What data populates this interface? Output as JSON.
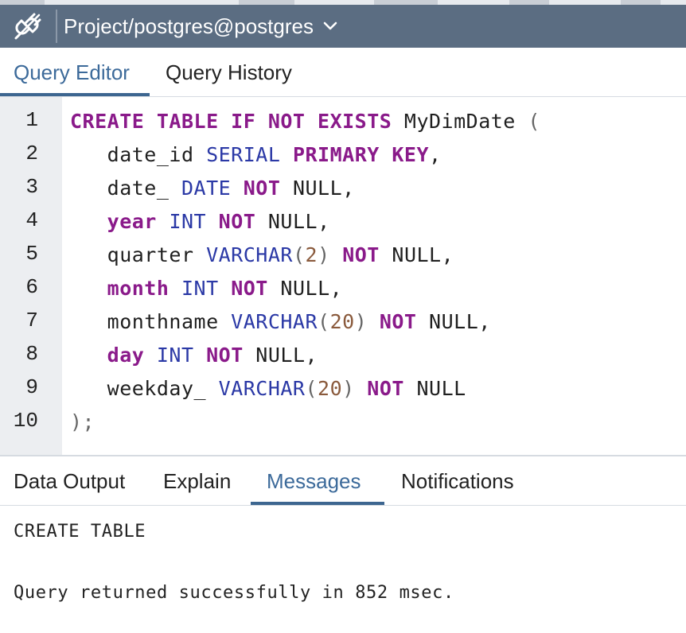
{
  "connection": {
    "label": "Project/postgres@postgres",
    "icon": "connection-plug-icon",
    "dropdown_icon": "chevron-down-icon"
  },
  "editor_tabs": [
    {
      "label": "Query Editor",
      "active": true
    },
    {
      "label": "Query History",
      "active": false
    }
  ],
  "editor": {
    "line_numbers": [
      "1",
      "2",
      "3",
      "4",
      "5",
      "6",
      "7",
      "8",
      "9",
      "10"
    ],
    "lines": [
      [
        {
          "t": "kw",
          "v": "CREATE TABLE IF NOT EXISTS"
        },
        {
          "t": "id",
          "v": " MyDimDate "
        },
        {
          "t": "pun",
          "v": "("
        }
      ],
      [
        {
          "t": "id",
          "v": "   date_id "
        },
        {
          "t": "ty",
          "v": "SERIAL"
        },
        {
          "t": "id",
          "v": " "
        },
        {
          "t": "kw",
          "v": "PRIMARY KEY"
        },
        {
          "t": "id",
          "v": ","
        }
      ],
      [
        {
          "t": "id",
          "v": "   date_ "
        },
        {
          "t": "ty",
          "v": "DATE"
        },
        {
          "t": "id",
          "v": " "
        },
        {
          "t": "kw",
          "v": "NOT"
        },
        {
          "t": "id",
          "v": " NULL,"
        }
      ],
      [
        {
          "t": "id",
          "v": "   "
        },
        {
          "t": "kw",
          "v": "year"
        },
        {
          "t": "id",
          "v": " "
        },
        {
          "t": "ty",
          "v": "INT"
        },
        {
          "t": "id",
          "v": " "
        },
        {
          "t": "kw",
          "v": "NOT"
        },
        {
          "t": "id",
          "v": " NULL,"
        }
      ],
      [
        {
          "t": "id",
          "v": "   quarter "
        },
        {
          "t": "ty",
          "v": "VARCHAR"
        },
        {
          "t": "pun",
          "v": "("
        },
        {
          "t": "num",
          "v": "2"
        },
        {
          "t": "pun",
          "v": ")"
        },
        {
          "t": "id",
          "v": " "
        },
        {
          "t": "kw",
          "v": "NOT"
        },
        {
          "t": "id",
          "v": " NULL,"
        }
      ],
      [
        {
          "t": "id",
          "v": "   "
        },
        {
          "t": "kw",
          "v": "month"
        },
        {
          "t": "id",
          "v": " "
        },
        {
          "t": "ty",
          "v": "INT"
        },
        {
          "t": "id",
          "v": " "
        },
        {
          "t": "kw",
          "v": "NOT"
        },
        {
          "t": "id",
          "v": " NULL,"
        }
      ],
      [
        {
          "t": "id",
          "v": "   monthname "
        },
        {
          "t": "ty",
          "v": "VARCHAR"
        },
        {
          "t": "pun",
          "v": "("
        },
        {
          "t": "num",
          "v": "20"
        },
        {
          "t": "pun",
          "v": ")"
        },
        {
          "t": "id",
          "v": " "
        },
        {
          "t": "kw",
          "v": "NOT"
        },
        {
          "t": "id",
          "v": " NULL,"
        }
      ],
      [
        {
          "t": "id",
          "v": "   "
        },
        {
          "t": "kw",
          "v": "day"
        },
        {
          "t": "id",
          "v": " "
        },
        {
          "t": "ty",
          "v": "INT"
        },
        {
          "t": "id",
          "v": " "
        },
        {
          "t": "kw",
          "v": "NOT"
        },
        {
          "t": "id",
          "v": " NULL,"
        }
      ],
      [
        {
          "t": "id",
          "v": "   weekday_ "
        },
        {
          "t": "ty",
          "v": "VARCHAR"
        },
        {
          "t": "pun",
          "v": "("
        },
        {
          "t": "num",
          "v": "20"
        },
        {
          "t": "pun",
          "v": ")"
        },
        {
          "t": "id",
          "v": " "
        },
        {
          "t": "kw",
          "v": "NOT"
        },
        {
          "t": "id",
          "v": " NULL"
        }
      ],
      [
        {
          "t": "pun",
          "v": ");"
        }
      ]
    ]
  },
  "output_tabs": [
    {
      "label": "Data Output",
      "active": false
    },
    {
      "label": "Explain",
      "active": false
    },
    {
      "label": "Messages",
      "active": true
    },
    {
      "label": "Notifications",
      "active": false
    }
  ],
  "messages": {
    "status": "CREATE TABLE",
    "result": "Query returned successfully in 852 msec."
  },
  "colors": {
    "toolbar": "#5b6d82",
    "accent": "#3c6a9a",
    "keyword": "#8a1a8a",
    "type": "#2b39a6",
    "number": "#8a5a3c",
    "gutter": "#eceef1"
  }
}
